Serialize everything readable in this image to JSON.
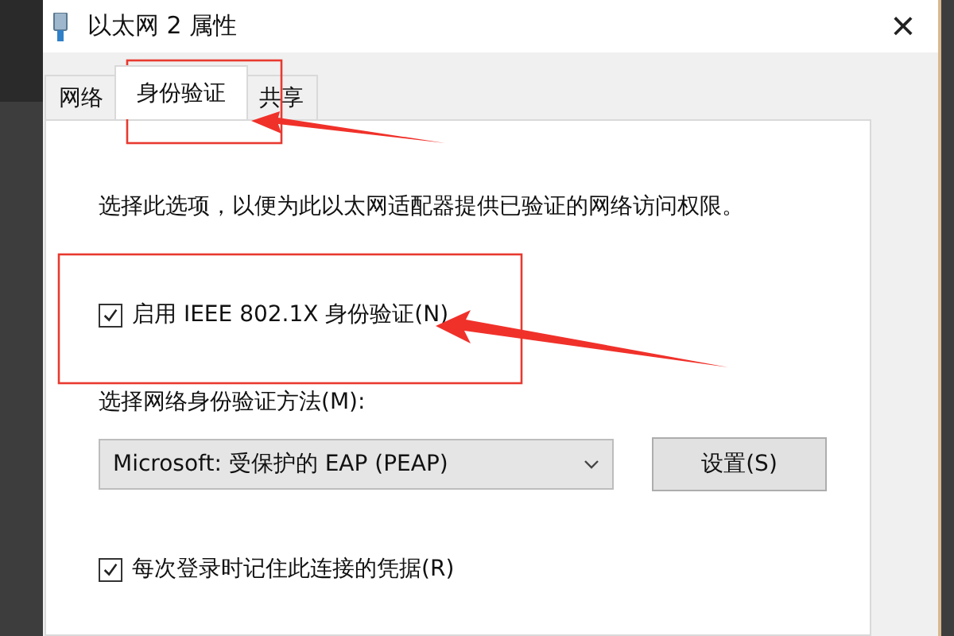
{
  "window": {
    "title": "以太网 2 属性",
    "close": "×"
  },
  "tabs": [
    {
      "label": "网络",
      "selected": false
    },
    {
      "label": "身份验证",
      "selected": true
    },
    {
      "label": "共享",
      "selected": false
    }
  ],
  "description": "选择此选项，以便为此以太网适配器提供已验证的网络访问权限。",
  "enable_checkbox": {
    "label": "启用 IEEE 802.1X 身份验证(N)",
    "checked": true
  },
  "method_label": "选择网络身份验证方法(M):",
  "method_dropdown": {
    "value": "Microsoft: 受保护的 EAP (PEAP)"
  },
  "settings_button": "设置(S)",
  "remember_checkbox": {
    "label": "每次登录时记住此连接的凭据(R)",
    "checked": true
  }
}
